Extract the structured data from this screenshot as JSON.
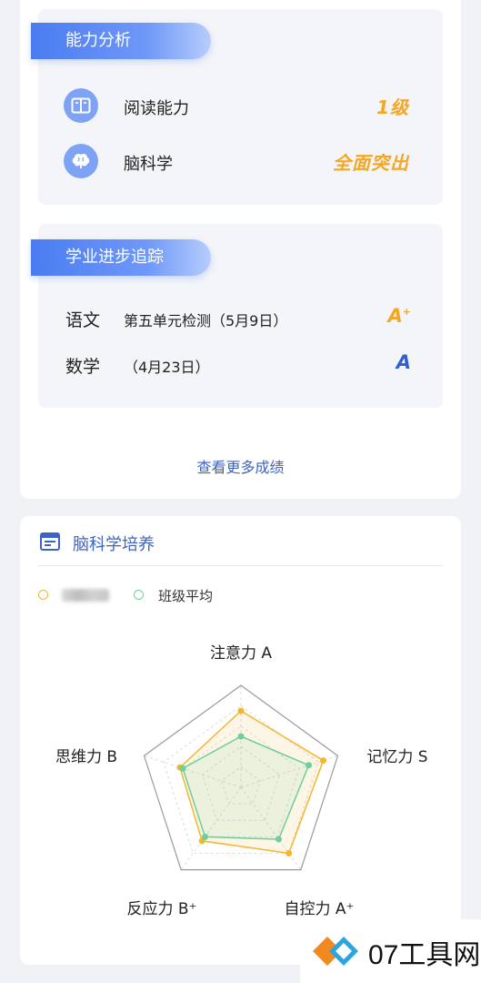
{
  "ability": {
    "title": "能力分析",
    "items": [
      {
        "label": "阅读能力",
        "value": "1级",
        "icon": "book-icon"
      },
      {
        "label": "脑科学",
        "value": "全面突出",
        "icon": "brain-icon"
      }
    ]
  },
  "progress": {
    "title": "学业进步追踪",
    "rows": [
      {
        "subject": "语文",
        "desc": "第五单元检测（5月9日）",
        "grade": "A",
        "grade_sup": "+",
        "grade_color": "#f5a623"
      },
      {
        "subject": "数学",
        "desc": "（4月23日）",
        "grade": "A",
        "grade_sup": "",
        "grade_color": "#2f5fd0"
      }
    ],
    "more_link": "查看更多成绩"
  },
  "brain_training": {
    "title": "脑科学培养",
    "title_icon": "list-card-icon",
    "legend": [
      {
        "label": "",
        "color": "#f2b631",
        "note": "student name (blurred)"
      },
      {
        "label": "班级平均",
        "color": "#6ecf9a"
      }
    ],
    "axes": [
      {
        "label": "注意力 A"
      },
      {
        "label": "记忆力 S"
      },
      {
        "label": "自控力 A⁺"
      },
      {
        "label": "反应力 B⁺"
      },
      {
        "label": "思维力 B"
      }
    ]
  },
  "chart_data": {
    "type": "radar",
    "categories": [
      "注意力",
      "记忆力",
      "自控力",
      "反应力",
      "思维力"
    ],
    "series": [
      {
        "values": [
          0.75,
          0.85,
          0.8,
          0.65,
          0.63
        ],
        "color": "#f2b631"
      },
      {
        "name": "班级平均",
        "values": [
          0.5,
          0.7,
          0.63,
          0.6,
          0.6
        ],
        "color": "#6ecf9a"
      }
    ],
    "range": [
      0,
      1
    ]
  },
  "watermark": {
    "text": "07工具网",
    "accent_colors": [
      "#f08a1e",
      "#2aa5e0"
    ]
  }
}
